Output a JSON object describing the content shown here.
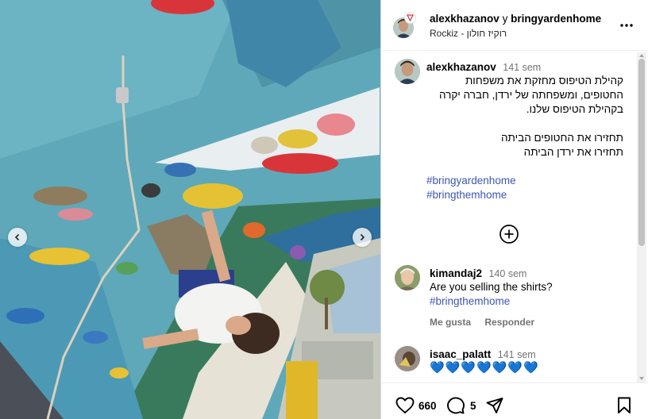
{
  "header": {
    "user1": "alexkhazanov",
    "conjunction": "y",
    "user2": "bringyardenhome",
    "subtitle": "Rockiz - רוקיז חולון",
    "more_icon": "more-horizontal-icon"
  },
  "caption": {
    "username": "alexkhazanov",
    "time": "141 sem",
    "lines": [
      "קהילת הטיפוס מחזקת את משפחות",
      "החטופים, ומשפחתה של ירדן, חברה יקרה",
      "בקהילת הטיפוס שלנו.",
      "תחזירו את החטופים הביתה",
      "תחזירו את ירדן הביתה"
    ],
    "hashtags": [
      "#bringyardenhome",
      "#bringthemhome"
    ]
  },
  "comments": [
    {
      "username": "kimandaj2",
      "time": "140 sem",
      "text": "Are you selling the shirts?",
      "hashtag": "#bringthemhome",
      "like_label": "Me gusta",
      "reply_label": "Responder"
    },
    {
      "username": "isaac_palatt",
      "time": "141 sem",
      "text": "💙💙💙💙💙💙💙"
    }
  ],
  "footer": {
    "likes": "660",
    "comments": "5"
  },
  "colors": {
    "hashtag": "#3d56b2",
    "heart_emoji": "#1877f2",
    "secondary_text": "#737373"
  }
}
